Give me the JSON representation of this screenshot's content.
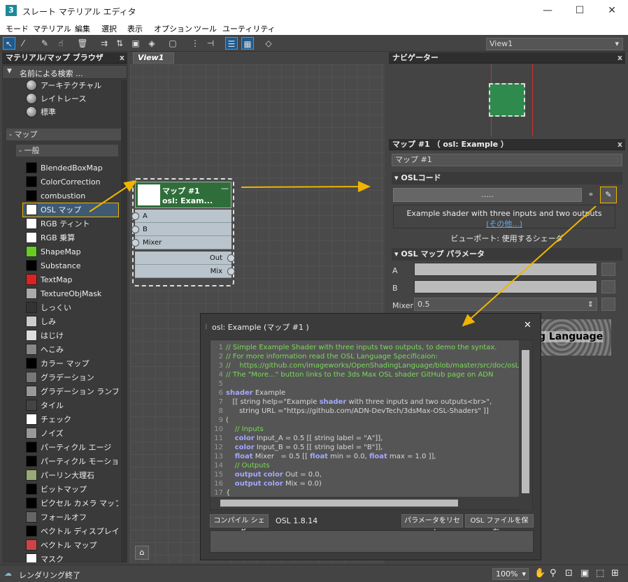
{
  "window": {
    "title": "スレート マテリアル エディタ",
    "app_icon": "3",
    "minimize": "—",
    "maximize": "☐",
    "close": "✕"
  },
  "menu": [
    "モード",
    "マテリアル",
    "編集",
    "選択",
    "表示",
    "オプション",
    "ツール",
    "ユーティリティ"
  ],
  "view_select": "View1",
  "browser": {
    "title": "マテリアル/マップ ブラウザ",
    "close": "x",
    "search": "名前による検索 ...",
    "top_items": [
      "アーキテクチャル",
      "レイトレース",
      "標準"
    ],
    "maps_section": "- マップ",
    "general_section": "- 一般",
    "items": [
      {
        "label": "BlendedBoxMap",
        "sw": "#000"
      },
      {
        "label": "ColorCorrection",
        "sw": "#000"
      },
      {
        "label": "combustion",
        "sw": "#000"
      },
      {
        "label": "OSL マップ",
        "sw": "#fff",
        "selected": true
      },
      {
        "label": "RGB ティント",
        "sw": "#fff"
      },
      {
        "label": "RGB 乗算",
        "sw": "#fff"
      },
      {
        "label": "ShapeMap",
        "sw": "#6c2"
      },
      {
        "label": "Substance",
        "sw": "#000"
      },
      {
        "label": "TextMap",
        "sw": "#d22"
      },
      {
        "label": "TextureObjMask",
        "sw": "#aaa"
      },
      {
        "label": "しっくい",
        "sw": "#333"
      },
      {
        "label": "しみ",
        "sw": "#ccc"
      },
      {
        "label": "はじけ",
        "sw": "#ddd"
      },
      {
        "label": "へこみ",
        "sw": "#888"
      },
      {
        "label": "カラー マップ",
        "sw": "#000"
      },
      {
        "label": "グラデーション",
        "sw": "#777"
      },
      {
        "label": "グラデーション ランプ",
        "sw": "#999"
      },
      {
        "label": "タイル",
        "sw": "#444"
      },
      {
        "label": "チェック",
        "sw": "#fff"
      },
      {
        "label": "ノイズ",
        "sw": "#999"
      },
      {
        "label": "パーティクル エージ",
        "sw": "#000"
      },
      {
        "label": "パーティクル モーショ...",
        "sw": "#000"
      },
      {
        "label": "パーリン大理石",
        "sw": "#9a7"
      },
      {
        "label": "ビットマップ",
        "sw": "#000"
      },
      {
        "label": "ピクセル カメラ マップ",
        "sw": "#000"
      },
      {
        "label": "フォールオフ",
        "sw": "#666"
      },
      {
        "label": "ベクトル ディスプレイ...",
        "sw": "#000"
      },
      {
        "label": "ベクトル マップ",
        "sw": "#c44"
      },
      {
        "label": "マスク",
        "sw": "#fff"
      }
    ]
  },
  "view1": {
    "tab": "View1",
    "node": {
      "title1": "マップ #1",
      "title2": "osl: Exam...",
      "collapse": "—",
      "inputs": [
        "A",
        "B",
        "Mixer"
      ],
      "outputs": [
        "Out",
        "Mix"
      ]
    }
  },
  "navigator": {
    "title": "ナビゲーター",
    "close": "x"
  },
  "props": {
    "title": "マップ #1 （ osl: Example ）",
    "close": "x",
    "name_field": "マップ #1",
    "osl_code_section": "OSLコード",
    "dots": ".....",
    "desc": "Example shader with three inputs and two outputs",
    "more": "(その他...)",
    "viewport": "ビューポート: 使用するシェーダ",
    "params_section": "OSL マップ パラメータ",
    "a": "A",
    "b": "B",
    "mixer": "Mixer",
    "mixer_val": "0.5",
    "preview_text": "g Language"
  },
  "dialog": {
    "title": "osl: Example (マップ #1 )",
    "close": "✕",
    "lines": [
      {
        "n": "1",
        "t": "// Simple Example Shader with three inputs two outputs, to demo the syntax.",
        "c": "cm"
      },
      {
        "n": "2",
        "t": "// For more information read the OSL Language Specificaion:",
        "c": "cm"
      },
      {
        "n": "3",
        "t": "//    https://github.com/imageworks/OpenShadingLanguage/blob/master/src/doc/osLa",
        "c": "cm"
      },
      {
        "n": "4",
        "t": "// The \"More...\" button links to the 3ds Max OSL shader GitHub page on ADN",
        "c": "cm"
      },
      {
        "n": "5",
        "t": "",
        "c": ""
      },
      {
        "n": "6",
        "t": "shader Example",
        "c": "kwl"
      },
      {
        "n": "7",
        "t": "   [[ string help=\"Example shader with three inputs and two outputs<br>\",",
        "c": ""
      },
      {
        "n": "8",
        "t": "      string URL =\"https://github.com/ADN-DevTech/3dsMax-OSL-Shaders\" ]]",
        "c": ""
      },
      {
        "n": "9",
        "t": "(",
        "c": ""
      },
      {
        "n": "10",
        "t": "    // Inputs",
        "c": "cm"
      },
      {
        "n": "11",
        "t": "    color Input_A = 0.5 [[ string label = \"A\"]],",
        "c": "kwl"
      },
      {
        "n": "12",
        "t": "    color Input_B = 0.5 [[ string label = \"B\"]],",
        "c": "kwl"
      },
      {
        "n": "13",
        "t": "    float Mixer   = 0.5 [[ float min = 0.0, float max = 1.0 ]],",
        "c": "kwl"
      },
      {
        "n": "14",
        "t": "    // Outputs",
        "c": "cm"
      },
      {
        "n": "15",
        "t": "    output color Out = 0.0,",
        "c": "kwl"
      },
      {
        "n": "16",
        "t": "    output color Mix = 0.0)",
        "c": "kwl"
      },
      {
        "n": "17",
        "t": "{",
        "c": ""
      }
    ],
    "compile": "コンパイル シェーダ",
    "version": "OSL 1.8.14",
    "reset": "パラメータをリセット",
    "save": "OSL ファイルを保存..."
  },
  "status": {
    "text": "レンダリング終了",
    "zoom": "100%"
  }
}
